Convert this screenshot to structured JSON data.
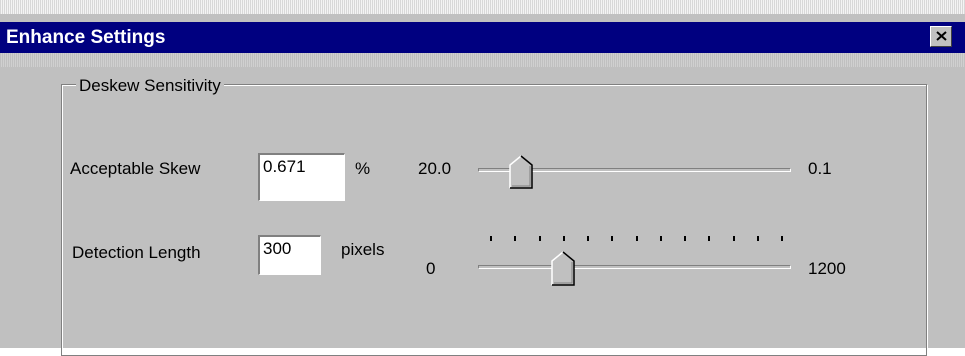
{
  "window": {
    "title": "Enhance Settings",
    "close_icon": "close-icon"
  },
  "group": {
    "label": "Deskew Sensitivity"
  },
  "skew": {
    "label": "Acceptable Skew",
    "value": "0.671",
    "unit": "%",
    "slider_min_label": "20.0",
    "slider_max_label": "0.1",
    "slider_position_fraction": 0.14
  },
  "detection": {
    "label": "Detection Length",
    "value": "300",
    "unit": "pixels",
    "slider_min_label": "0",
    "slider_max_label": "1200",
    "slider_position_fraction": 0.25,
    "tick_count": 13
  },
  "colors": {
    "titlebar": "#000080",
    "dialog_bg": "#c0c0c0",
    "title_text": "#ffffff"
  }
}
